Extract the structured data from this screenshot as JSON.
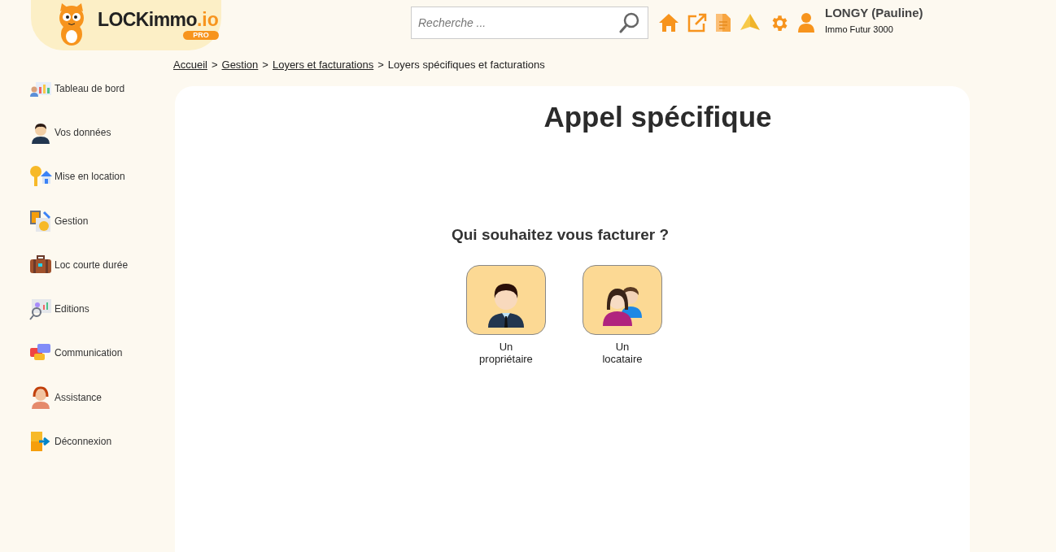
{
  "logo": {
    "brand": "LOCKimmo",
    "suffix": ".io",
    "badge": "PRO"
  },
  "search": {
    "placeholder": "Recherche ..."
  },
  "user": {
    "name": "LONGY (Pauline)",
    "agency": "Immo Futur 3000"
  },
  "sidebar": {
    "items": [
      {
        "label": "Tableau de bord"
      },
      {
        "label": "Vos données"
      },
      {
        "label": "Mise en location"
      },
      {
        "label": "Gestion"
      },
      {
        "label": "Loc courte durée"
      },
      {
        "label": "Editions"
      },
      {
        "label": "Communication"
      },
      {
        "label": "Assistance"
      },
      {
        "label": "Déconnexion"
      }
    ]
  },
  "breadcrumb": [
    {
      "label": "Accueil",
      "link": true
    },
    {
      "label": "Gestion",
      "link": true
    },
    {
      "label": "Loyers et facturations",
      "link": true
    },
    {
      "label": "Loyers spécifiques et facturations",
      "link": false
    }
  ],
  "separator": ">",
  "page": {
    "title": "Appel spécifique",
    "question": "Qui souhaitez vous facturer ?",
    "choices": [
      {
        "kind": "owner",
        "line1": "Un",
        "line2": "propriétaire"
      },
      {
        "kind": "tenant",
        "line1": "Un",
        "line2": "locataire"
      }
    ]
  }
}
